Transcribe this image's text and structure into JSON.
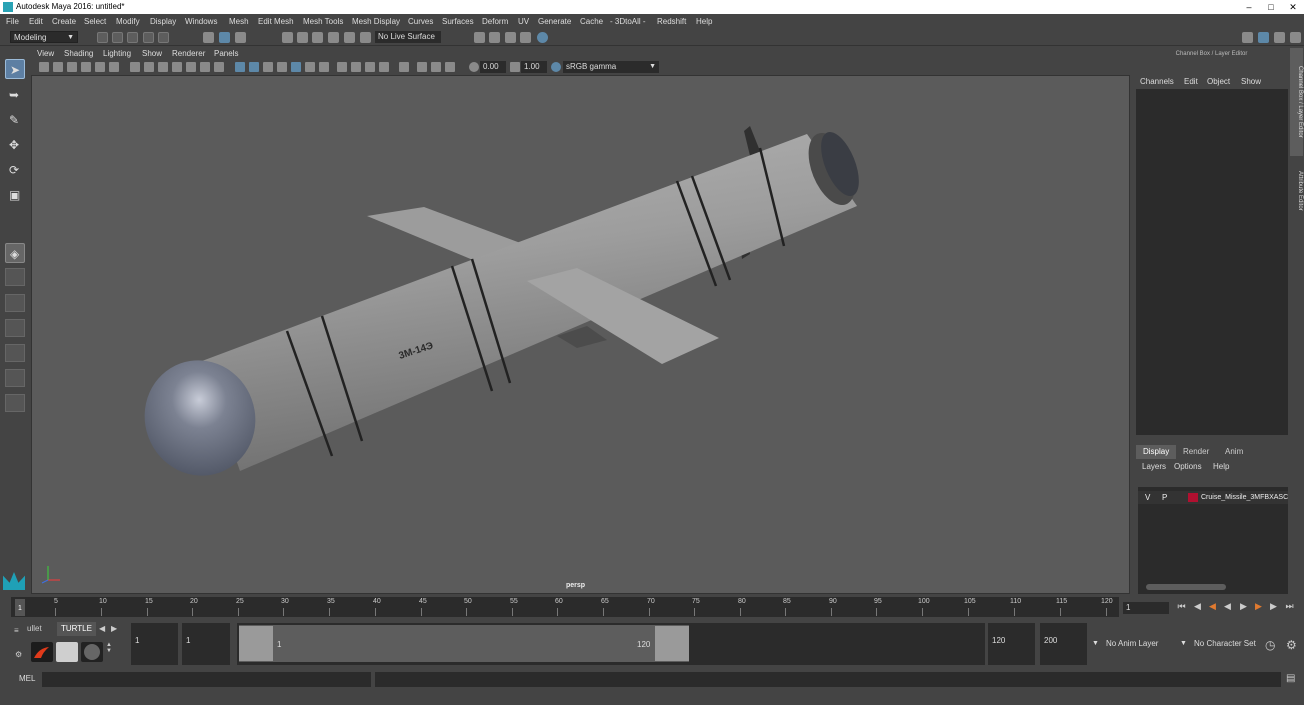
{
  "window": {
    "title": "Autodesk Maya 2016: untitled*"
  },
  "menubar": [
    "File",
    "Edit",
    "Create",
    "Select",
    "Modify",
    "Display",
    "Windows",
    "Mesh",
    "Edit Mesh",
    "Mesh Tools",
    "Mesh Display",
    "Curves",
    "Surfaces",
    "Deform",
    "UV",
    "Generate",
    "Cache",
    "- 3DtoAll -",
    "Redshift",
    "Help"
  ],
  "shelfbar": {
    "mode": "Modeling",
    "live_surface": "No Live Surface"
  },
  "viewport": {
    "menu": [
      "View",
      "Shading",
      "Lighting",
      "Show",
      "Renderer",
      "Panels"
    ],
    "gamma_low": "0.00",
    "exposure": "1.00",
    "color_space": "sRGB gamma",
    "camera_label": "persp",
    "model_marking": "3M-14Э"
  },
  "channel_box": {
    "header": "Channel Box / Layer Editor",
    "menu": [
      "Channels",
      "Edit",
      "Object",
      "Show"
    ],
    "tabs": [
      "Display",
      "Render",
      "Anim"
    ],
    "layer_menu": [
      "Layers",
      "Options",
      "Help"
    ],
    "layer": {
      "v": "V",
      "p": "P",
      "name": "Cruise_Missile_3MFBXASC",
      "color": "#b01030"
    },
    "side_tabs": [
      "Channel Box / Layer Editor",
      "Attribute Editor"
    ]
  },
  "timeline": {
    "ticks": [
      "5",
      "10",
      "15",
      "20",
      "25",
      "30",
      "35",
      "40",
      "45",
      "50",
      "55",
      "60",
      "65",
      "70",
      "75",
      "80",
      "85",
      "90",
      "95",
      "100",
      "105",
      "110",
      "115",
      "120"
    ],
    "current_frame": "1",
    "frame_field": "1"
  },
  "shelf": {
    "tabs": [
      "ullet",
      "TURTLE"
    ]
  },
  "range": {
    "start": "1",
    "min": "1",
    "slider_start": "1",
    "slider_end": "120",
    "end": "120",
    "max": "200",
    "anim_layer": "No Anim Layer",
    "character_set": "No Character Set"
  },
  "cmdline": {
    "label": "MEL"
  }
}
